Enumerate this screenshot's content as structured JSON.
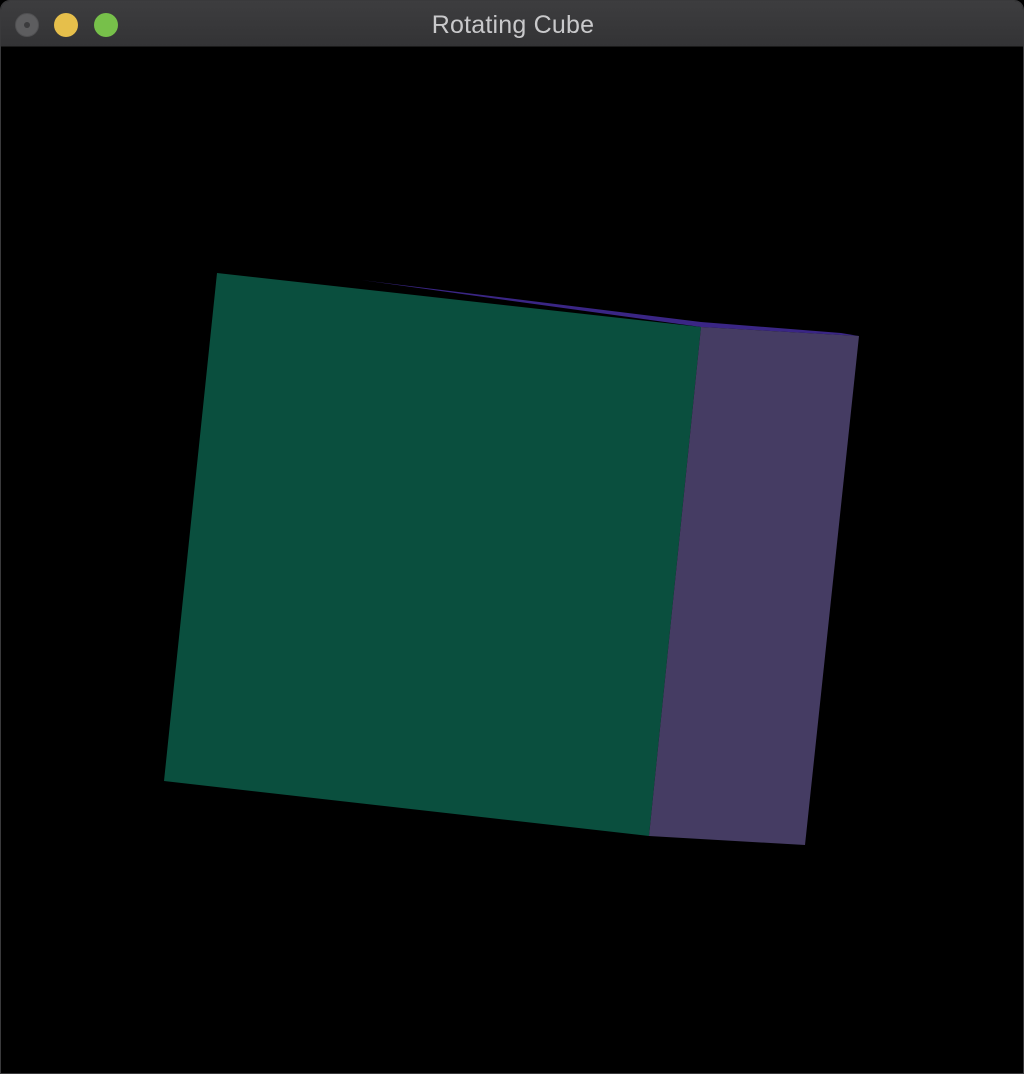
{
  "window": {
    "title": "Rotating Cube",
    "controls": {
      "close_icon": "close-icon-inactive",
      "minimize_icon": "minimize-icon",
      "zoom_icon": "zoom-icon",
      "close_color": "#5d5d5f",
      "minimize_color": "#e6bf4b",
      "zoom_color": "#77c04a"
    }
  },
  "scene": {
    "background_color": "#000000",
    "cube_faces": [
      {
        "name": "front-face",
        "color": "#0a4f3e"
      },
      {
        "name": "side-face",
        "color": "#453c63"
      },
      {
        "name": "top-face",
        "color": "#3a2685"
      }
    ]
  }
}
